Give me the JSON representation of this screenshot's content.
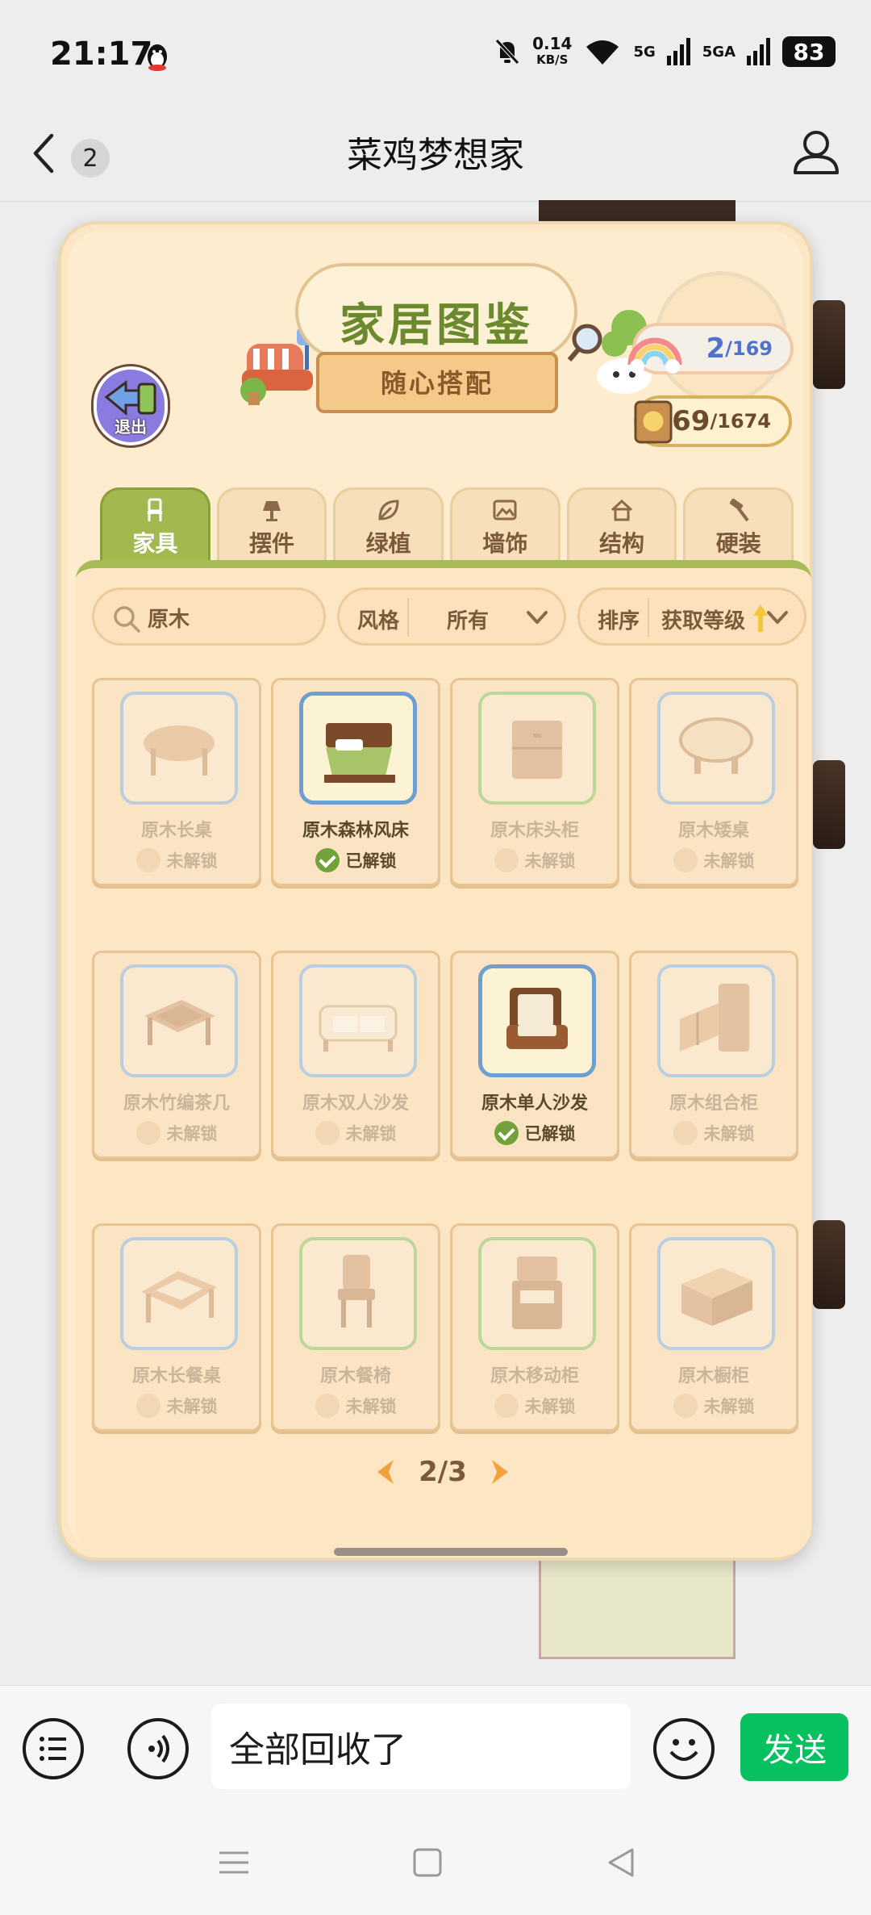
{
  "status_bar": {
    "time": "21:17",
    "net_speed_value": "0.14",
    "net_speed_unit": "KB/S",
    "signal_1": "5G",
    "signal_2": "5GA",
    "battery": "83",
    "icons": [
      "qq-penguin-icon",
      "mute-bell-icon",
      "wifi-icon",
      "signal-icon",
      "battery-icon"
    ]
  },
  "header": {
    "back_count": "2",
    "title": "菜鸡梦想家"
  },
  "game": {
    "exit_label": "退出",
    "banner_title": "家居图鉴",
    "banner_subtitle": "随心搭配",
    "rainbow_count": "2",
    "rainbow_total": "/169",
    "coin_count": "69",
    "coin_total": "/1674",
    "tabs": [
      {
        "label": "家具",
        "icon": "chair-icon",
        "active": true
      },
      {
        "label": "摆件",
        "icon": "lamp-icon",
        "active": false
      },
      {
        "label": "绿植",
        "icon": "leaf-icon",
        "active": false
      },
      {
        "label": "墙饰",
        "icon": "picture-icon",
        "active": false
      },
      {
        "label": "结构",
        "icon": "house-icon",
        "active": false
      },
      {
        "label": "硬装",
        "icon": "hammer-icon",
        "active": false
      }
    ],
    "search_value": "原木",
    "style_filter_label": "风格",
    "style_filter_value": "所有",
    "sort_label": "排序",
    "sort_value": "获取等级",
    "items": [
      {
        "name": "原木长桌",
        "status": "未解锁",
        "unlocked": false
      },
      {
        "name": "原木森林风床",
        "status": "已解锁",
        "unlocked": true
      },
      {
        "name": "原木床头柜",
        "status": "未解锁",
        "unlocked": false
      },
      {
        "name": "原木矮桌",
        "status": "未解锁",
        "unlocked": false
      },
      {
        "name": "原木竹编茶几",
        "status": "未解锁",
        "unlocked": false
      },
      {
        "name": "原木双人沙发",
        "status": "未解锁",
        "unlocked": false
      },
      {
        "name": "原木单人沙发",
        "status": "已解锁",
        "unlocked": true
      },
      {
        "name": "原木组合柜",
        "status": "未解锁",
        "unlocked": false
      },
      {
        "name": "原木长餐桌",
        "status": "未解锁",
        "unlocked": false
      },
      {
        "name": "原木餐椅",
        "status": "未解锁",
        "unlocked": false
      },
      {
        "name": "原木移动柜",
        "status": "未解锁",
        "unlocked": false
      },
      {
        "name": "原木橱柜",
        "status": "未解锁",
        "unlocked": false
      }
    ],
    "page_indicator": "2/3"
  },
  "input_bar": {
    "message_text": "全部回收了",
    "send_label": "发送"
  },
  "colors": {
    "accent_green": "#07c160",
    "tab_active": "#a3b84e",
    "unlocked_text": "#5a4a2a",
    "locked_text": "#c9b69a"
  }
}
